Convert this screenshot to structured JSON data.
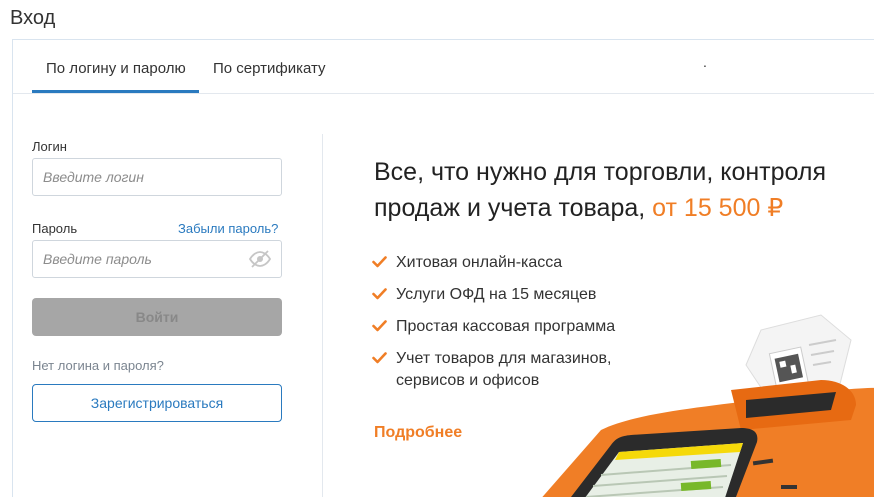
{
  "page": {
    "title": "Вход"
  },
  "tabs": [
    {
      "label": "По логину и паролю",
      "active": true
    },
    {
      "label": "По сертификату",
      "active": false
    }
  ],
  "tab_extra": ".",
  "form": {
    "login_label": "Логин",
    "login_placeholder": "Введите логин",
    "login_value": "",
    "password_label": "Пароль",
    "forgot_label": "Забыли пароль?",
    "password_placeholder": "Введите пароль",
    "password_value": "",
    "submit_label": "Войти",
    "no_account_text": "Нет логина и пароля?",
    "register_label": "Зарегистрироваться"
  },
  "promo": {
    "title": "Все, что нужно для торговли, контроля продаж и учета товара,",
    "price": "от 15 500 ₽",
    "features": [
      "Хитовая онлайн-касса",
      "Услуги ОФД на 15 месяцев",
      "Простая кассовая программа",
      "Учет товаров для магазинов, сервисов и офисов"
    ],
    "more_label": "Подробнее"
  },
  "colors": {
    "accent_blue": "#2a7abf",
    "accent_orange": "#f07e26",
    "button_disabled": "#a6a6a6"
  }
}
